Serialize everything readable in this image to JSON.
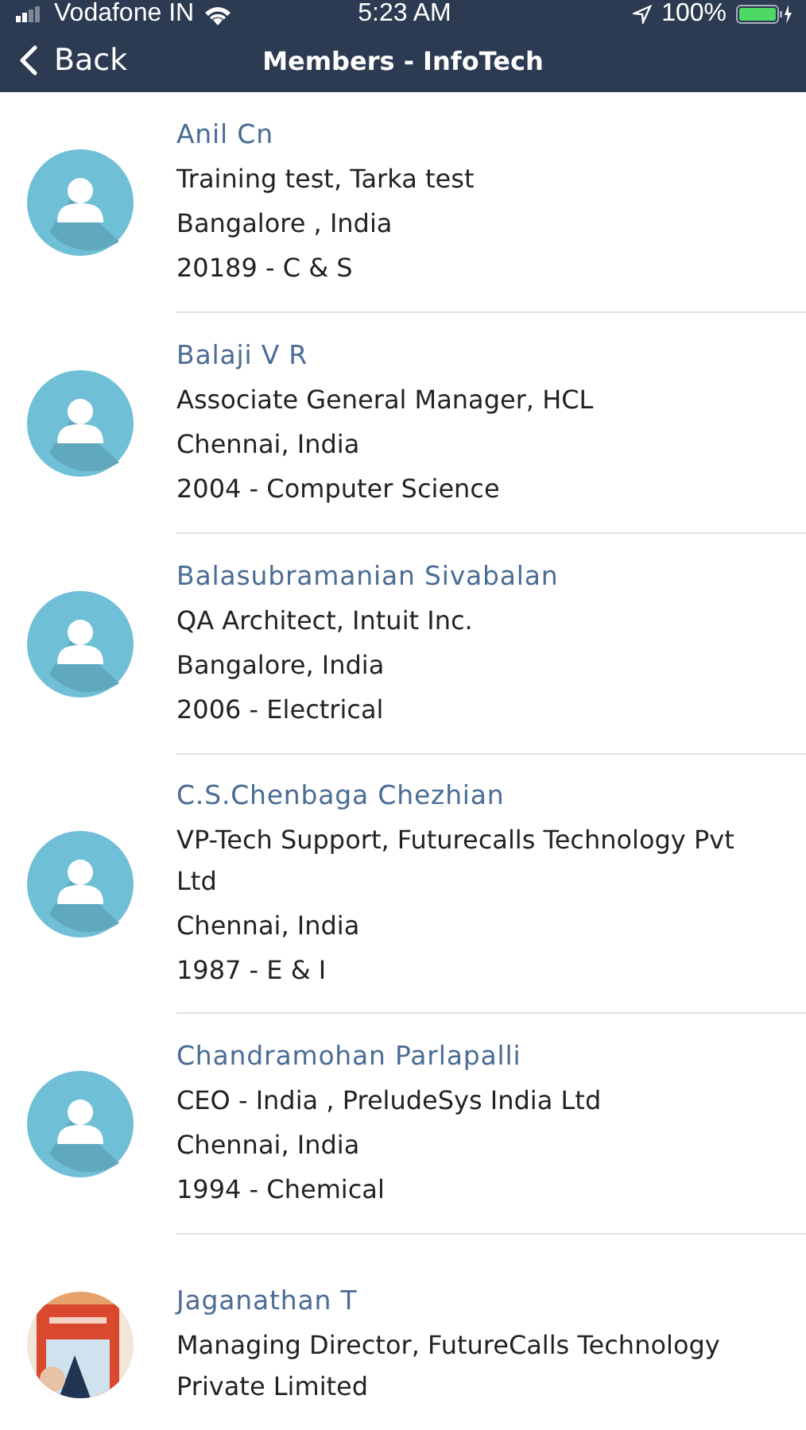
{
  "status_bar": {
    "carrier": "Vodafone IN",
    "time": "5:23 AM",
    "battery": "100%"
  },
  "nav": {
    "back": "Back",
    "title": "Members - InfoTech"
  },
  "members": [
    {
      "name": "Anil Cn",
      "role": "Training test, Tarka test",
      "location": "Bangalore , India",
      "batch": "20189 - C & S",
      "kind": "default"
    },
    {
      "name": "Balaji V R",
      "role": "Associate General Manager, HCL",
      "location": "Chennai, India",
      "batch": "2004 - Computer Science",
      "kind": "default"
    },
    {
      "name": "Balasubramanian Sivabalan",
      "role": "QA Architect, Intuit Inc.",
      "location": "Bangalore, India",
      "batch": "2006 - Electrical",
      "kind": "default"
    },
    {
      "name": "C.S.Chenbaga Chezhian",
      "role": "VP-Tech Support, Futurecalls Technology Pvt Ltd",
      "location": "Chennai, India",
      "batch": "1987 - E & I",
      "kind": "default"
    },
    {
      "name": "Chandramohan Parlapalli",
      "role": "CEO - India , PreludeSys India Ltd",
      "location": "Chennai, India",
      "batch": "1994 - Chemical",
      "kind": "default"
    },
    {
      "name": "Jaganathan T",
      "role": "Managing Director, FutureCalls Technology Private Limited",
      "kind": "picture"
    }
  ]
}
